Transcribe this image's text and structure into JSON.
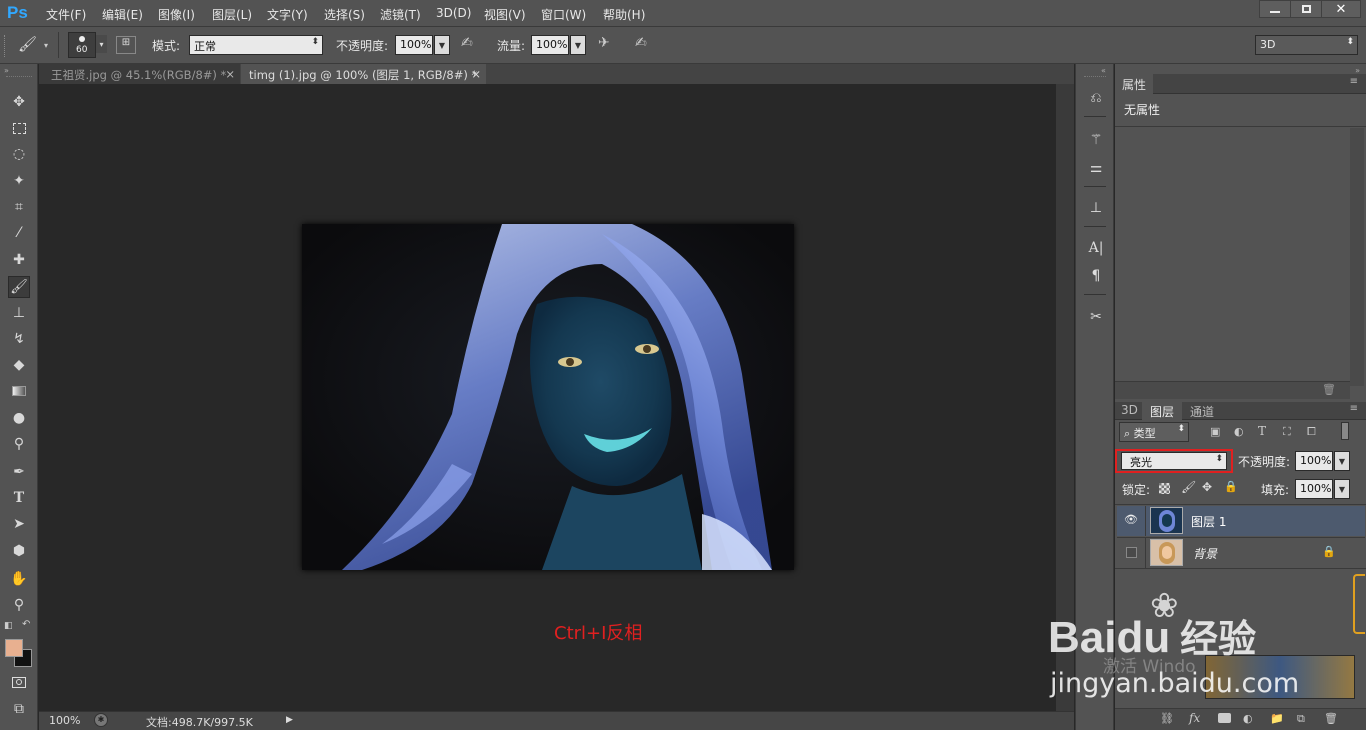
{
  "app": {
    "logo": "Ps"
  },
  "menu": [
    "文件(F)",
    "编辑(E)",
    "图像(I)",
    "图层(L)",
    "文字(Y)",
    "选择(S)",
    "滤镜(T)",
    "3D(D)",
    "视图(V)",
    "窗口(W)",
    "帮助(H)"
  ],
  "window_controls": {
    "minimize": "minimize-icon",
    "restore": "restore-icon",
    "close": "close-icon"
  },
  "options": {
    "brush_size": "60",
    "mode_label": "模式:",
    "mode_value": "正常",
    "opacity_label": "不透明度:",
    "opacity_value": "100%",
    "flow_label": "流量:",
    "flow_value": "100%",
    "workspace": "3D"
  },
  "tabs": [
    {
      "label": "王祖贤.jpg @ 45.1%(RGB/8#) *",
      "close": "×"
    },
    {
      "label": "timg (1).jpg @ 100% (图层 1, RGB/8#) *",
      "close": "×"
    }
  ],
  "canvas": {
    "annotation": "Ctrl+I反相"
  },
  "status": {
    "zoom": "100%",
    "doc": "文档:498.7K/997.5K"
  },
  "properties": {
    "tab": "属性",
    "content": "无属性"
  },
  "layers_panel": {
    "tabs": [
      "3D",
      "图层",
      "通道"
    ],
    "filter_kind": "类型",
    "blend_mode": "亮光",
    "opacity_label": "不透明度:",
    "opacity_value": "100%",
    "lock_label": "锁定:",
    "fill_label": "填充:",
    "fill_value": "100%",
    "layers": [
      {
        "name": "图层 1",
        "visible": true,
        "selected": true
      },
      {
        "name": "背景",
        "visible": false,
        "locked": true
      }
    ]
  },
  "watermark": {
    "brand_a": "Bai",
    "brand_b": "du",
    "brand_c": "经验",
    "url": "jingyan.baidu.com",
    "activate": "激活 Windo"
  },
  "colors": {
    "accent": "#31a8ff",
    "highlight_box": "#e02020",
    "annotation": "#e02020",
    "fg_swatch": "#e8b090",
    "bg_swatch": "#111111",
    "selected_layer": "#4d5a6e"
  }
}
